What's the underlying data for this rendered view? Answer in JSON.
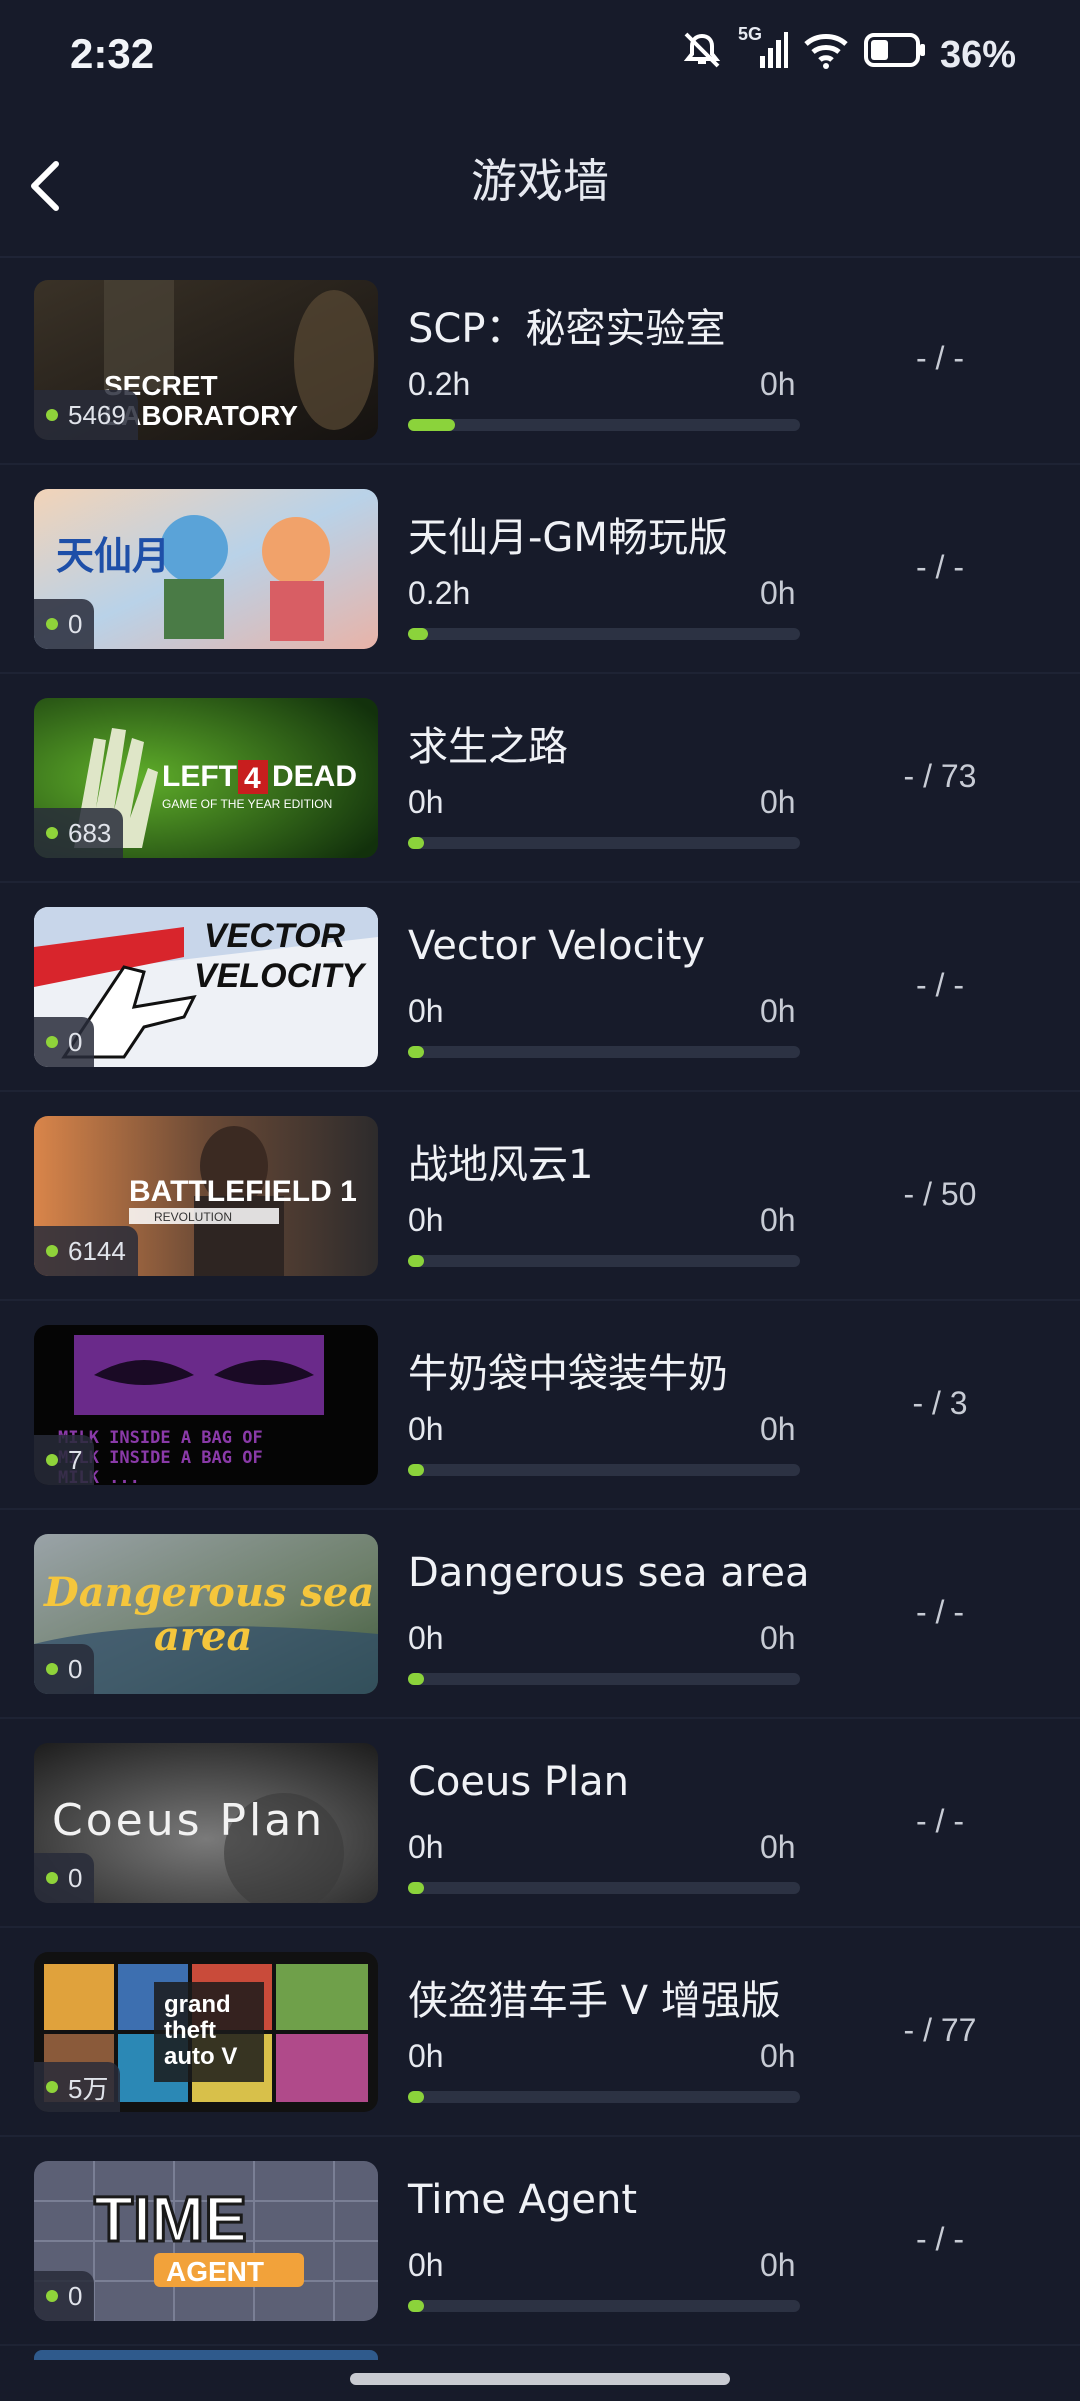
{
  "status": {
    "time": "2:32",
    "network": "5G",
    "battery": "36%"
  },
  "header": {
    "title": "游戏墙"
  },
  "games": [
    {
      "name": "SCP：秘密实验室",
      "players": "5469",
      "played": "0.2h",
      "recent": "0h",
      "achievements": "- / -",
      "progress": 0.12,
      "thumb_text": "SECRET LABORATORY"
    },
    {
      "name": "天仙月-GM畅玩版",
      "players": "0",
      "played": "0.2h",
      "recent": "0h",
      "achievements": "- / -",
      "progress": 0.05,
      "thumb_text": "天仙月"
    },
    {
      "name": "求生之路",
      "players": "683",
      "played": "0h",
      "recent": "0h",
      "achievements": "- / 73",
      "progress": 0.04,
      "thumb_text": "LEFT 4 DEAD"
    },
    {
      "name": "Vector Velocity",
      "players": "0",
      "played": "0h",
      "recent": "0h",
      "achievements": "- / -",
      "progress": 0.04,
      "thumb_text": "VECTOR VELOCITY"
    },
    {
      "name": "战地风云1",
      "players": "6144",
      "played": "0h",
      "recent": "0h",
      "achievements": "- / 50",
      "progress": 0.04,
      "thumb_text": "BATTLEFIELD 1"
    },
    {
      "name": "牛奶袋中袋装牛奶",
      "players": "7",
      "played": "0h",
      "recent": "0h",
      "achievements": "- / 3",
      "progress": 0.04,
      "thumb_text": "MILK INSIDE A BAG OF"
    },
    {
      "name": "Dangerous sea area",
      "players": "0",
      "played": "0h",
      "recent": "0h",
      "achievements": "- / -",
      "progress": 0.04,
      "thumb_text": "Dangerous sea area"
    },
    {
      "name": "Coeus Plan",
      "players": "0",
      "played": "0h",
      "recent": "0h",
      "achievements": "- / -",
      "progress": 0.04,
      "thumb_text": "Coeus Plan"
    },
    {
      "name": "侠盗猎车手 V 增强版",
      "players": "5万",
      "played": "0h",
      "recent": "0h",
      "achievements": "- / 77",
      "progress": 0.04,
      "thumb_text": "grand theft auto V"
    },
    {
      "name": "Time Agent",
      "players": "0",
      "played": "0h",
      "recent": "0h",
      "achievements": "- / -",
      "progress": 0.04,
      "thumb_text": "TIME AGENT"
    }
  ]
}
